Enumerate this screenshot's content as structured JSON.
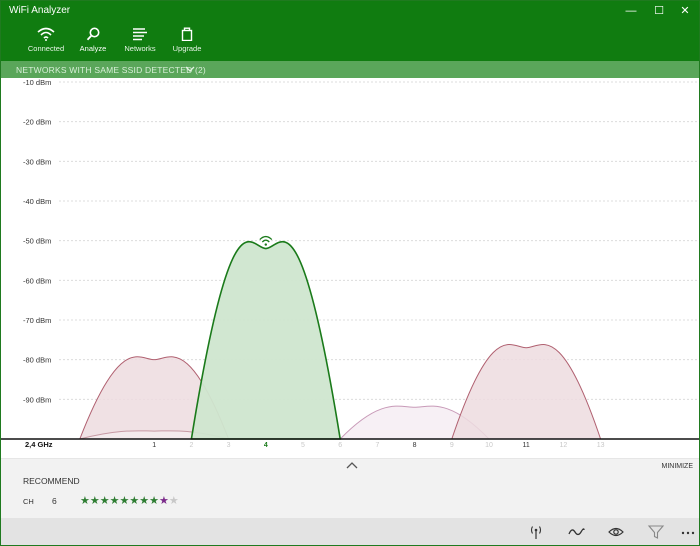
{
  "app": {
    "title": "WiFi Analyzer"
  },
  "window_controls": {
    "minimize": "—",
    "maximize": "☐",
    "close": "✕"
  },
  "nav": {
    "items": [
      {
        "id": "connected",
        "label": "Connected",
        "icon": "wifi-icon",
        "active": false
      },
      {
        "id": "analyze",
        "label": "Analyze",
        "icon": "magnifier-icon",
        "active": true
      },
      {
        "id": "networks",
        "label": "Networks",
        "icon": "list-icon",
        "active": false
      },
      {
        "id": "upgrade",
        "label": "Upgrade",
        "icon": "bag-icon",
        "active": false
      }
    ]
  },
  "ssid_bar": {
    "text": "NETWORKS WITH SAME SSID DETECTED (2)"
  },
  "chart_data": {
    "type": "area",
    "y_axis": {
      "unit": "dBm",
      "ticks": [
        "-10 dBm",
        "-20 dBm",
        "-30 dBm",
        "-40 dBm",
        "-50 dBm",
        "-60 dBm",
        "-70 dBm",
        "-80 dBm",
        "-90 dBm"
      ],
      "ylim": [
        -100,
        -10
      ]
    },
    "x_axis": {
      "band_label": "2,4 GHz",
      "channels": [
        {
          "ch": 1,
          "label": "1",
          "emphasis": "bold"
        },
        {
          "ch": 2,
          "label": "2",
          "emphasis": "faint"
        },
        {
          "ch": 3,
          "label": "3",
          "emphasis": "faint"
        },
        {
          "ch": 4,
          "label": "4",
          "emphasis": "strong"
        },
        {
          "ch": 5,
          "label": "5",
          "emphasis": "faint"
        },
        {
          "ch": 6,
          "label": "6",
          "emphasis": "faint"
        },
        {
          "ch": 7,
          "label": "7",
          "emphasis": "faint"
        },
        {
          "ch": 8,
          "label": "8",
          "emphasis": "bold"
        },
        {
          "ch": 9,
          "label": "9",
          "emphasis": "faint"
        },
        {
          "ch": 10,
          "label": "10",
          "emphasis": "faint"
        },
        {
          "ch": 11,
          "label": "11",
          "emphasis": "bold"
        },
        {
          "ch": 12,
          "label": "12",
          "emphasis": "faint"
        },
        {
          "ch": 13,
          "label": "13",
          "emphasis": "faint"
        }
      ]
    },
    "grid": true,
    "series": [
      {
        "center_ch": 1,
        "from_ch": -1,
        "to_ch": 3,
        "peak_dbm": -80,
        "color": "#b06070",
        "fill": "#eddcdf",
        "current": false
      },
      {
        "center_ch": 1,
        "from_ch": -1,
        "to_ch": 3,
        "peak_dbm": -98,
        "color": "#c79aa4",
        "fill": "#f5ecee",
        "current": false
      },
      {
        "center_ch": 4,
        "from_ch": 2,
        "to_ch": 6,
        "peak_dbm": -52,
        "color": "#1a7a1a",
        "fill": "#cfe6cf",
        "current": true
      },
      {
        "center_ch": 8,
        "from_ch": 6,
        "to_ch": 10,
        "peak_dbm": -92,
        "color": "#c89ab8",
        "fill": "#f6edf3",
        "current": false
      },
      {
        "center_ch": 11,
        "from_ch": 9,
        "to_ch": 13,
        "peak_dbm": -77,
        "color": "#b06070",
        "fill": "#eddcdf",
        "current": false
      }
    ]
  },
  "recommend": {
    "collapse_icon": "chevron-up-icon",
    "minimize_label": "MINIMIZE",
    "title": "RECOMMEND",
    "ch_label": "CH",
    "ch_value": "6",
    "rating": {
      "stars_total": 10,
      "stars_filled": 9,
      "colors": {
        "filled": "#2e7d32",
        "last_filled": "#7b2a8a",
        "empty": "#c8c8c8"
      }
    }
  },
  "commands": [
    {
      "id": "signal",
      "icon": "antenna-icon"
    },
    {
      "id": "graph",
      "icon": "wave-icon"
    },
    {
      "id": "view",
      "icon": "eye-icon"
    },
    {
      "id": "filter",
      "icon": "filter-icon"
    },
    {
      "id": "more",
      "icon": "more-icon"
    }
  ],
  "colors": {
    "accent": "#107c10",
    "ssid_bar": "#5aa65a",
    "panel_bg": "#f2f2f2",
    "cmdbar_bg": "#e3e3e3"
  }
}
